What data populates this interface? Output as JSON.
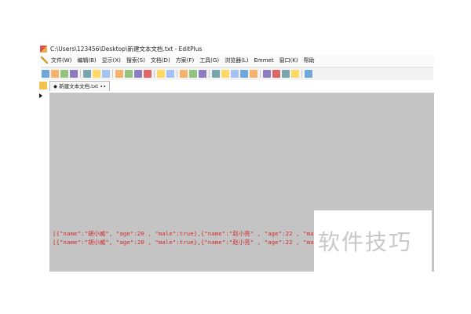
{
  "window": {
    "title": "C:\\Users\\123456\\Desktop\\新建文本文档.txt - EditPlus"
  },
  "menu": {
    "items": [
      "文件(W)",
      "编辑(B)",
      "显示(X)",
      "搜索(S)",
      "文档(D)",
      "方案(F)",
      "工具(G)",
      "浏览器(L)",
      "Emmet",
      "窗口(K)",
      "帮助"
    ]
  },
  "toolbar": {
    "icons": [
      "new-file-icon",
      "open-folder-icon",
      "save-icon",
      "save-all-icon",
      "separator",
      "print-icon",
      "print-preview-icon",
      "spell-check-icon",
      "separator",
      "cut-icon",
      "copy-icon",
      "paste-icon",
      "delete-icon",
      "separator",
      "undo-icon",
      "redo-icon",
      "separator",
      "find-icon",
      "replace-icon",
      "go-to-icon",
      "separator",
      "font-icon",
      "heading-icon",
      "word-wrap-icon",
      "ruler-icon",
      "line-number-icon",
      "separator",
      "window-icon",
      "cascade-icon",
      "tile-icon",
      "full-screen-icon",
      "separator",
      "help-icon"
    ]
  },
  "tabs": [
    {
      "label": "新建文本文档.txt"
    }
  ],
  "editor": {
    "lines": [
      "[{\"name\":\"胡小威\", \"age\":20 , \"male\":true},{\"name\":\"赵小亮\" , \"age\":22 , \"male\":false}]",
      "[{\"name\":\"胡小威\", \"age\":20 , \"male\":true},{\"name\":\"赵小亮\" , \"age\":22 , \"male\":false}]"
    ],
    "text_color": "#d22a2a",
    "background": "#c4c4c4"
  },
  "watermark": {
    "text": "软件技巧"
  }
}
